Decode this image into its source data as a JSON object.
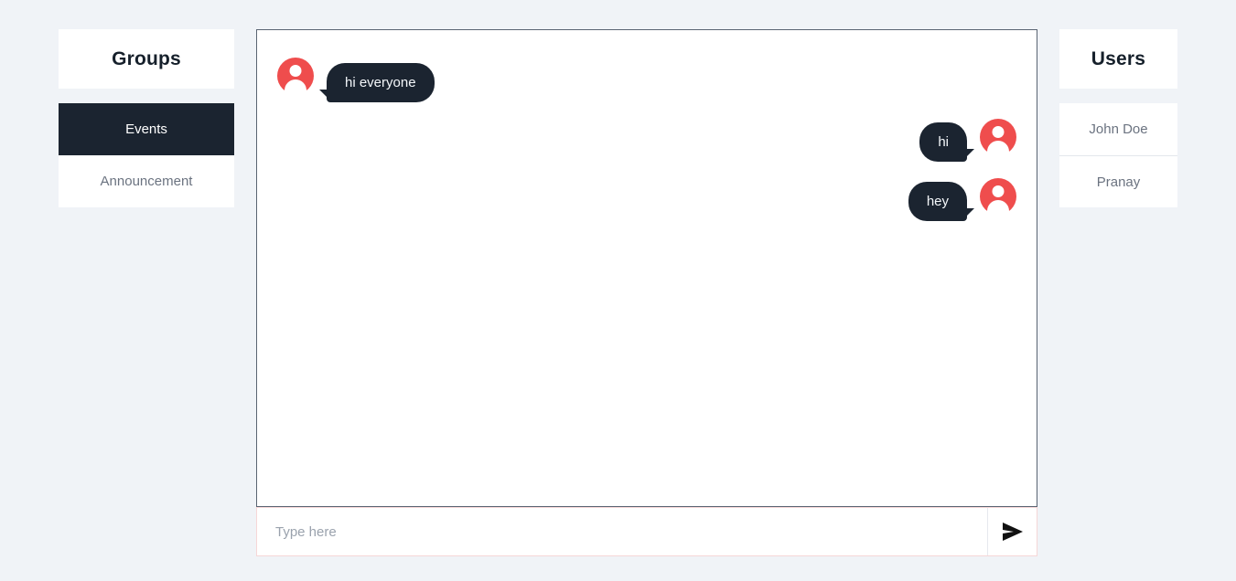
{
  "theme": {
    "background": "#f0f3f7",
    "card": "#ffffff",
    "dark": "#1b2430",
    "avatar_red": "#ef4d4d",
    "muted_text": "#6b7380",
    "panel_border": "#5a6472",
    "input_border": "#f6d7d7"
  },
  "groups_panel": {
    "title": "Groups",
    "items": [
      {
        "label": "Events",
        "active": true
      },
      {
        "label": "Announcement",
        "active": false
      }
    ]
  },
  "chat": {
    "messages": [
      {
        "text": "hi everyone",
        "side": "incoming",
        "avatar": "person-avatar"
      },
      {
        "text": "hi",
        "side": "outgoing",
        "avatar": "person-avatar"
      },
      {
        "text": "hey",
        "side": "outgoing",
        "avatar": "person-avatar"
      }
    ]
  },
  "composer": {
    "placeholder": "Type here",
    "value": "",
    "send_icon": "send-icon"
  },
  "users_panel": {
    "title": "Users",
    "items": [
      {
        "label": "John Doe"
      },
      {
        "label": "Pranay"
      }
    ]
  }
}
